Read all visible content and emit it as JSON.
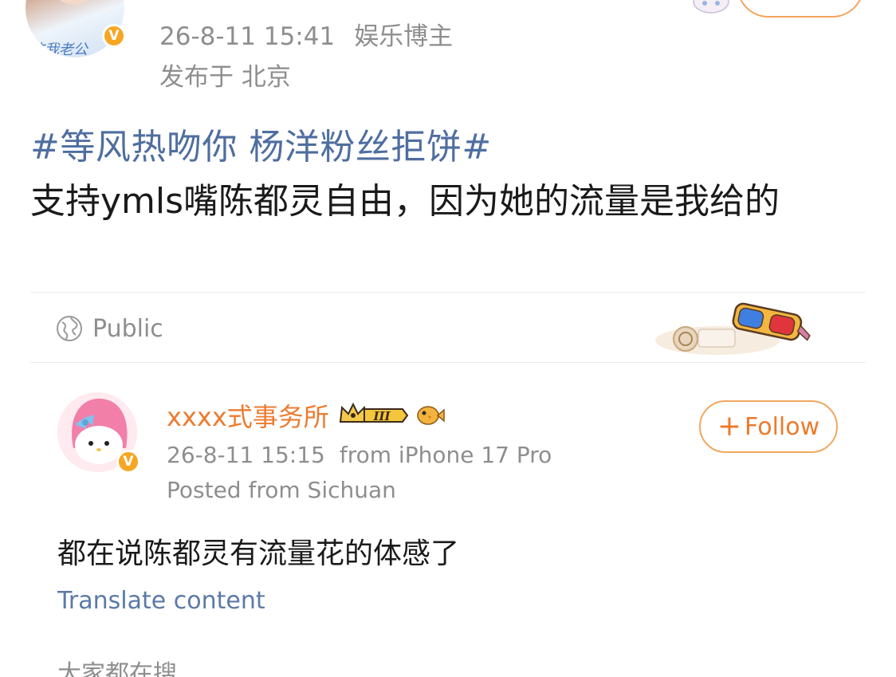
{
  "post": {
    "author_caption": "这我老公",
    "verified_mark": "V",
    "timestamp": "26-8-11 15:41",
    "author_tag": "娱乐博主",
    "location": "发布于 北京",
    "hashtag": "#等风热吻你 杨洋粉丝拒饼#",
    "body": "支持ymls嘴陈都灵自由，因为她的流量是我给的",
    "visibility": "Public"
  },
  "comment": {
    "username": "xxxx式事务所",
    "level_badge": "III",
    "verified_mark": "V",
    "timestamp": "26-8-11 15:15",
    "device": "from iPhone 17 Pro",
    "location": "Posted from Sichuan",
    "follow_plus": "+",
    "follow_label": "Follow",
    "text": "都在说陈都灵有流量花的体感了",
    "translate_label": "Translate content"
  },
  "footer": {
    "hot_search_label": "大家都在搜"
  },
  "colors": {
    "link_blue": "#4f6ea0",
    "username_orange": "#ec7b2f",
    "meta_gray": "#8e8e8e",
    "verified_gold": "#f6a623"
  }
}
